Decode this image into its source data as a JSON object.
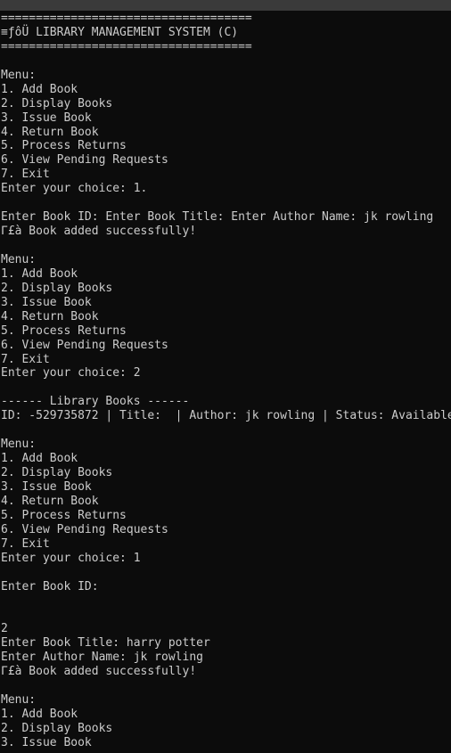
{
  "terminal": {
    "lines": [
      "====================================",
      "≡ƒôÜ LIBRARY MANAGEMENT SYSTEM (C)",
      "====================================",
      "",
      "Menu:",
      "1. Add Book",
      "2. Display Books",
      "3. Issue Book",
      "4. Return Book",
      "5. Process Returns",
      "6. View Pending Requests",
      "7. Exit",
      "Enter your choice: 1.",
      "",
      "Enter Book ID: Enter Book Title: Enter Author Name: jk rowling",
      "Γ£à Book added successfully!",
      "",
      "Menu:",
      "1. Add Book",
      "2. Display Books",
      "3. Issue Book",
      "4. Return Book",
      "5. Process Returns",
      "6. View Pending Requests",
      "7. Exit",
      "Enter your choice: 2",
      "",
      "------ Library Books ------",
      "ID: -529735872 | Title:  | Author: jk rowling | Status: Available",
      "",
      "Menu:",
      "1. Add Book",
      "2. Display Books",
      "3. Issue Book",
      "4. Return Book",
      "5. Process Returns",
      "6. View Pending Requests",
      "7. Exit",
      "Enter your choice: 1",
      "",
      "Enter Book ID:",
      "",
      "",
      "2",
      "Enter Book Title: harry potter",
      "Enter Author Name: jk rowling",
      "Γ£à Book added successfully!",
      "",
      "Menu:",
      "1. Add Book",
      "2. Display Books",
      "3. Issue Book"
    ]
  }
}
